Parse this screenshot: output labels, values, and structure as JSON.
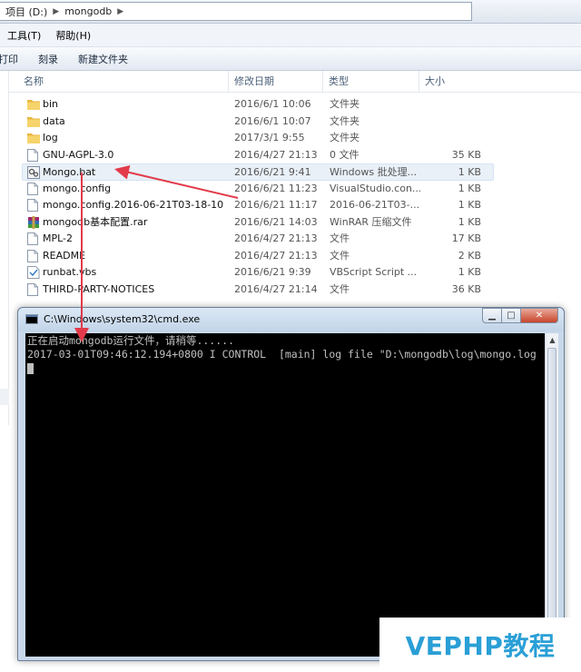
{
  "address": {
    "crumbs": [
      "项目 (D:)",
      "mongodb"
    ]
  },
  "menu": [
    "工具(T)",
    "帮助(H)"
  ],
  "commands": [
    "打印",
    "刻录",
    "新建文件夹"
  ],
  "columns": {
    "name": "名称",
    "date": "修改日期",
    "type": "类型",
    "size": "大小"
  },
  "files": [
    {
      "name": "bin",
      "date": "2016/6/1 10:06",
      "type": "文件夹",
      "size": "",
      "icon": "folder-icon"
    },
    {
      "name": "data",
      "date": "2016/6/1 10:07",
      "type": "文件夹",
      "size": "",
      "icon": "folder-icon"
    },
    {
      "name": "log",
      "date": "2017/3/1 9:55",
      "type": "文件夹",
      "size": "",
      "icon": "folder-icon"
    },
    {
      "name": "GNU-AGPL-3.0",
      "date": "2016/4/27 21:13",
      "type": "0 文件",
      "size": "35 KB",
      "icon": "file-icon"
    },
    {
      "name": "Mongo.bat",
      "date": "2016/6/21 9:41",
      "type": "Windows 批处理...",
      "size": "1 KB",
      "icon": "bat-file-icon"
    },
    {
      "name": "mongo.config",
      "date": "2016/6/21 11:23",
      "type": "VisualStudio.con...",
      "size": "1 KB",
      "icon": "file-icon"
    },
    {
      "name": "mongo.config.2016-06-21T03-18-10",
      "date": "2016/6/21 11:17",
      "type": "2016-06-21T03-...",
      "size": "1 KB",
      "icon": "file-icon"
    },
    {
      "name": "mongodb基本配置.rar",
      "date": "2016/6/21 14:03",
      "type": "WinRAR 压缩文件",
      "size": "1 KB",
      "icon": "rar-file-icon"
    },
    {
      "name": "MPL-2",
      "date": "2016/4/27 21:13",
      "type": "文件",
      "size": "17 KB",
      "icon": "file-icon"
    },
    {
      "name": "README",
      "date": "2016/4/27 21:13",
      "type": "文件",
      "size": "2 KB",
      "icon": "file-icon"
    },
    {
      "name": "runbat.vbs",
      "date": "2016/6/21 9:39",
      "type": "VBScript Script ...",
      "size": "1 KB",
      "icon": "vbs-file-icon"
    },
    {
      "name": "THIRD-PARTY-NOTICES",
      "date": "2016/4/27 21:14",
      "type": "文件",
      "size": "36 KB",
      "icon": "file-icon"
    }
  ],
  "cmd": {
    "title": "C:\\Windows\\system32\\cmd.exe",
    "line1": "正在启动mongodb运行文件，请稍等......",
    "line2": "2017-03-01T09:46:12.194+0800 I CONTROL  [main] log file \"D:\\mongodb\\log\\mongo.log"
  },
  "watermark": "VEPHP教程",
  "colors": {
    "accent": "#2a9fd6",
    "arrow": "#e23a4a",
    "console_bg": "#000000",
    "console_fg": "#c0c0c0"
  }
}
